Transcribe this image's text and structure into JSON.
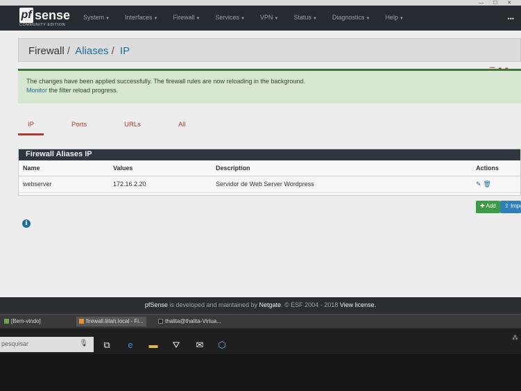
{
  "window": {
    "controls": "— ☐ ✕"
  },
  "navbar": {
    "brand_pf": "pf",
    "brand_sense": "sense",
    "brand_edition": "COMMUNITY EDITION",
    "menu": [
      "System",
      "Interfaces",
      "Firewall",
      "Services",
      "VPN",
      "Status",
      "Diagnostics",
      "Help"
    ],
    "right": "•••"
  },
  "breadcrumb": {
    "root": "Firewall",
    "section": "Aliases",
    "current": "IP"
  },
  "alert": {
    "line1": "The changes have been applied successfully. The firewall rules are now reloading in the background.",
    "monitor_link": "Monitor",
    "line2_rest": " the filter reload progress."
  },
  "tabs": [
    {
      "label": "IP",
      "active": true
    },
    {
      "label": "Ports",
      "active": false
    },
    {
      "label": "URLs",
      "active": false
    },
    {
      "label": "All",
      "active": false
    }
  ],
  "panel": {
    "title": "Firewall Aliases IP",
    "columns": {
      "name": "Name",
      "values": "Values",
      "description": "Description",
      "actions": "Actions"
    },
    "rows": [
      {
        "name": "webserver",
        "values": "172.16.2.20",
        "description": "Servidor de Web Server Wordpress"
      }
    ]
  },
  "buttons": {
    "add": "Add",
    "import": "Import"
  },
  "footer": {
    "brand": "pfSense",
    "text1": " is developed and maintained by ",
    "company": "Netgate",
    "text2": ". © ESF 2004 - 2018 ",
    "license": "View license."
  },
  "taskbar_apps": [
    {
      "label": "[Bem-vindo]",
      "color": "#6aa84f"
    },
    {
      "label": "firewall.liitah.local - Fi...",
      "color": "#e69138"
    },
    {
      "label": "thalita@thalita-Virtua...",
      "color": "#222222"
    }
  ],
  "search": {
    "placeholder": "pesquisar"
  },
  "colors": {
    "accent": "#b03a2e",
    "link": "#1f6d9c",
    "success": "#3c763d",
    "navbar": "#262b31"
  }
}
